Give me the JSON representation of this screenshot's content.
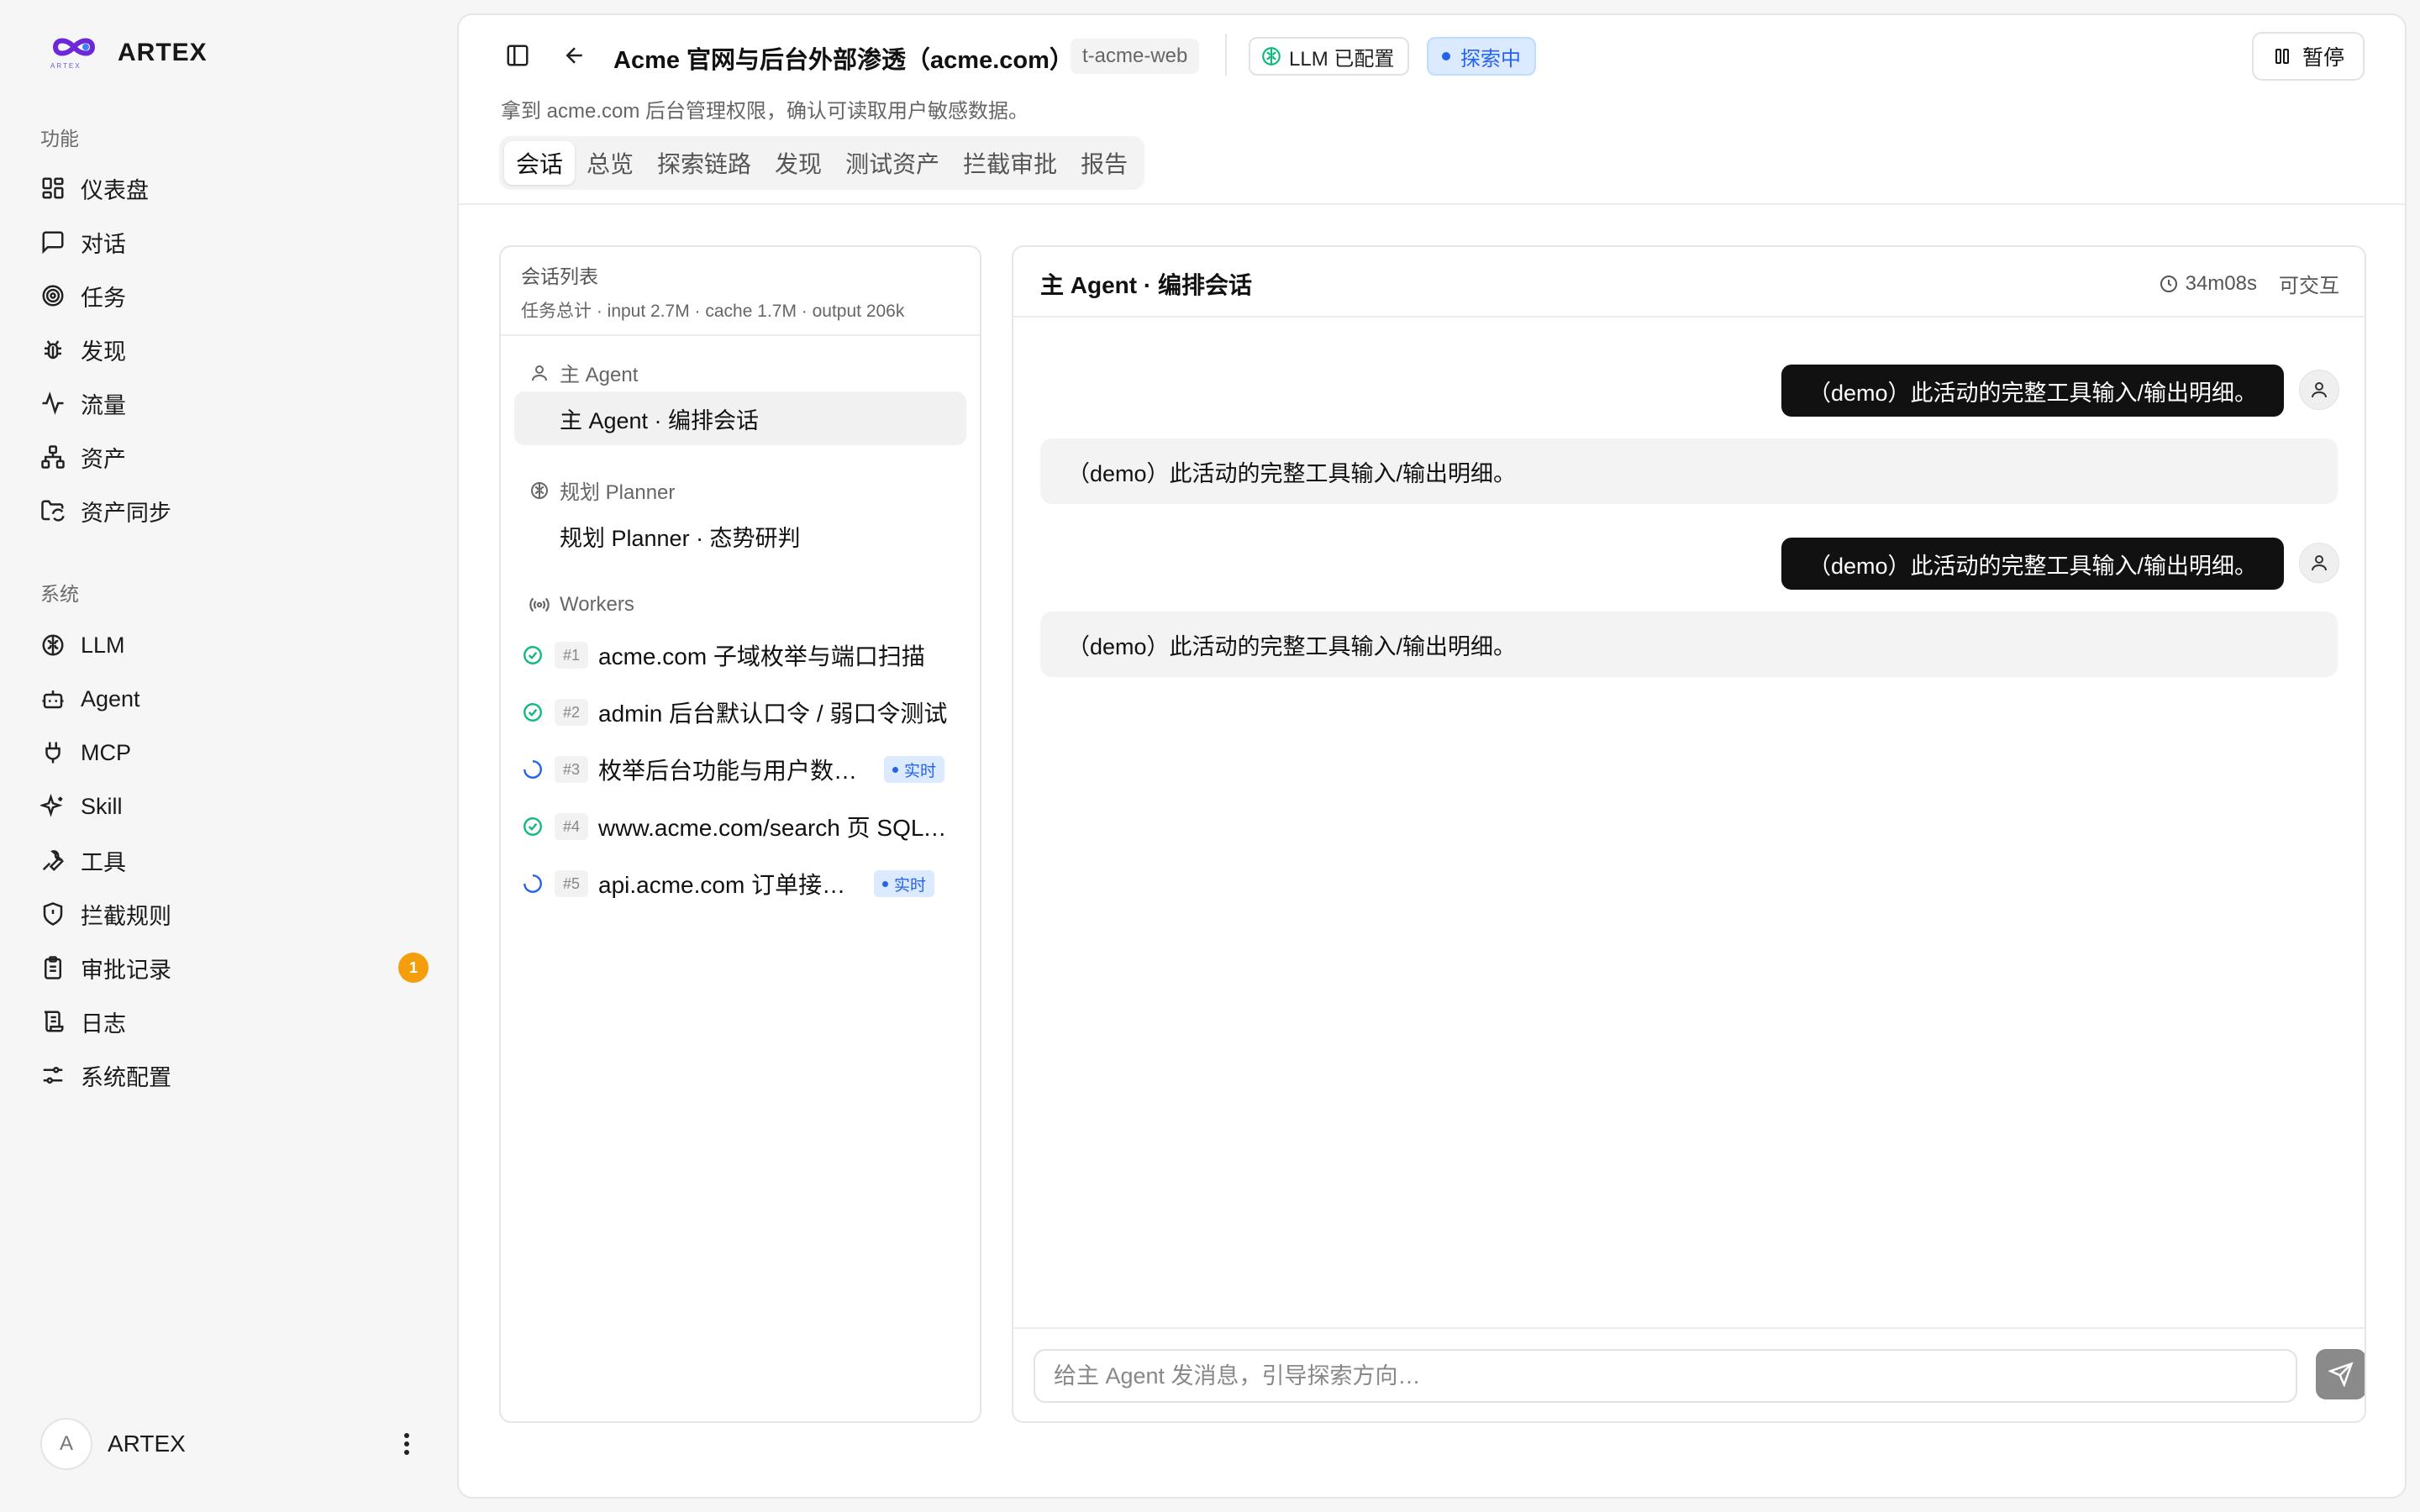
{
  "app": {
    "brand": "ARTEX",
    "logo_sub": "ARTEX"
  },
  "sidebar": {
    "sections": [
      {
        "title": "功能",
        "items": [
          {
            "label": "仪表盘",
            "icon": "dashboard-icon"
          },
          {
            "label": "对话",
            "icon": "chat-icon"
          },
          {
            "label": "任务",
            "icon": "target-icon"
          },
          {
            "label": "发现",
            "icon": "bug-icon"
          },
          {
            "label": "流量",
            "icon": "activity-icon"
          },
          {
            "label": "资产",
            "icon": "network-icon"
          },
          {
            "label": "资产同步",
            "icon": "folder-sync-icon"
          }
        ]
      },
      {
        "title": "系统",
        "items": [
          {
            "label": "LLM",
            "icon": "brain-icon"
          },
          {
            "label": "Agent",
            "icon": "bot-icon"
          },
          {
            "label": "MCP",
            "icon": "plug-icon"
          },
          {
            "label": "Skill",
            "icon": "sparkles-icon"
          },
          {
            "label": "工具",
            "icon": "wrench-icon"
          },
          {
            "label": "拦截规则",
            "icon": "shield-icon"
          },
          {
            "label": "审批记录",
            "icon": "clipboard-icon",
            "badge": "1"
          },
          {
            "label": "日志",
            "icon": "scroll-icon"
          },
          {
            "label": "系统配置",
            "icon": "sliders-icon"
          }
        ]
      }
    ],
    "user": {
      "initial": "A",
      "name": "ARTEX"
    }
  },
  "header": {
    "title": "Acme 官网与后台外部渗透（acme.com）",
    "task_id": "t-acme-web",
    "llm_status": "LLM 已配置",
    "run_status": "探索中",
    "pause_label": "暂停",
    "description": "拿到 acme.com 后台管理权限，确认可读取用户敏感数据。",
    "tabs": [
      {
        "label": "会话",
        "active": true
      },
      {
        "label": "总览",
        "active": false
      },
      {
        "label": "探索链路",
        "active": false
      },
      {
        "label": "发现",
        "active": false
      },
      {
        "label": "测试资产",
        "active": false
      },
      {
        "label": "拦截审批",
        "active": false
      },
      {
        "label": "报告",
        "active": false
      }
    ]
  },
  "sessions": {
    "title": "会话列表",
    "totals": "任务总计 · input 2.7M · cache 1.7M · output 206k",
    "main_group": "主 Agent",
    "main_item": "主 Agent · 编排会话",
    "planner_group": "规划 Planner",
    "planner_item": "规划 Planner · 态势研判",
    "workers_group": "Workers",
    "workers": [
      {
        "num": "#1",
        "label": "acme.com 子域枚举与端口扫描",
        "status": "done",
        "live": false
      },
      {
        "num": "#2",
        "label": "admin 后台默认口令 / 弱口令测试",
        "status": "done",
        "live": false
      },
      {
        "num": "#3",
        "label": "枚举后台功能与用户数据接口",
        "status": "running",
        "live": true
      },
      {
        "num": "#4",
        "label": "www.acme.com/search 页 SQL 注入验证",
        "status": "done",
        "live": false
      },
      {
        "num": "#5",
        "label": "api.acme.com 订单接口越权测试",
        "status": "running",
        "live": true
      }
    ],
    "live_label": "实时"
  },
  "chat": {
    "title": "主 Agent · 编排会话",
    "elapsed": "34m08s",
    "mode": "可交互",
    "messages": [
      {
        "role": "user",
        "text": "（demo）此活动的完整工具输入/输出明细。"
      },
      {
        "role": "assistant",
        "text": "（demo）此活动的完整工具输入/输出明细。"
      },
      {
        "role": "user",
        "text": "（demo）此活动的完整工具输入/输出明细。"
      },
      {
        "role": "assistant",
        "text": "（demo）此活动的完整工具输入/输出明细。"
      }
    ],
    "input_placeholder": "给主 Agent 发消息，引导探索方向…",
    "input_value": ""
  },
  "colors": {
    "accent": "#2563eb",
    "success": "#10b981",
    "badge": "#f59e0b",
    "dark": "#111111"
  }
}
